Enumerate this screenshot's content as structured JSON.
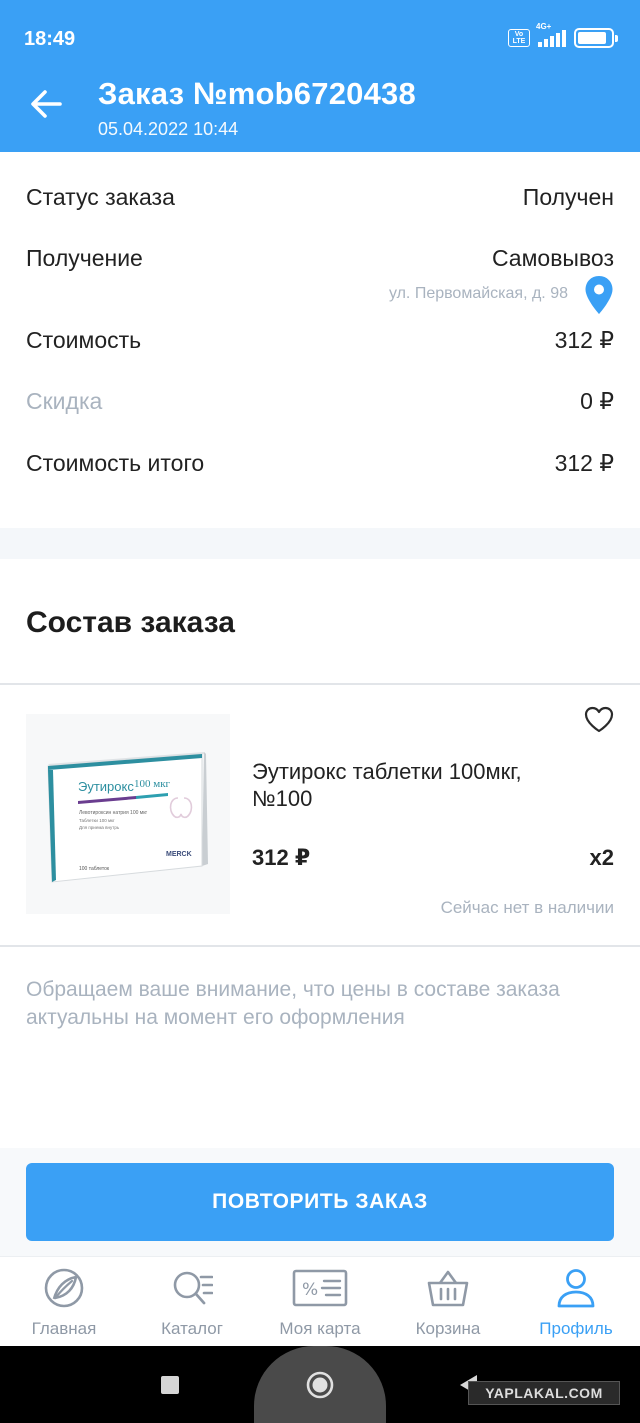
{
  "status_bar": {
    "time": "18:49",
    "network": "4G+",
    "volte": "Vo LTE"
  },
  "header": {
    "title": "Заказ №mob6720438",
    "date": "05.04.2022 10:44"
  },
  "order_info": {
    "status_label": "Статус заказа",
    "status_value": "Получен",
    "delivery_label": "Получение",
    "delivery_value": "Самовывоз",
    "address": "ул. Первомайская, д. 98",
    "cost_label": "Стоимость",
    "cost_value": "312 ₽",
    "discount_label": "Скидка",
    "discount_value": "0 ₽",
    "total_label": "Стоимость итого",
    "total_value": "312 ₽"
  },
  "composition": {
    "title": "Состав заказа",
    "items": [
      {
        "name": "Эутирокс таблетки 100мкг, №100",
        "price": "312 ₽",
        "qty": "x2",
        "stock": "Сейчас нет в наличии",
        "package": {
          "brand": "Эутирокс",
          "dose": "100 мкг",
          "substance": "Левотироксин натрия 100 мкг",
          "line1": "Таблетки 100 мкг",
          "line2": "Для приема внутрь",
          "count": "100 таблеток",
          "maker": "MERCK"
        }
      }
    ]
  },
  "notice": "Обращаем ваше внимание, что цены в составе заказа актуальны на момент его оформления",
  "actions": {
    "repeat_label": "ПОВТОРИТЬ ЗАКАЗ"
  },
  "bottom_nav": [
    {
      "label": "Главная",
      "icon": "home-leaf-icon"
    },
    {
      "label": "Каталог",
      "icon": "catalog-search-icon"
    },
    {
      "label": "Моя карта",
      "icon": "discount-card-icon"
    },
    {
      "label": "Корзина",
      "icon": "basket-icon"
    },
    {
      "label": "Профиль",
      "icon": "profile-icon",
      "active": true
    }
  ],
  "watermark": "YAPLAKAL.COM",
  "colors": {
    "primary": "#3aa0f5",
    "muted": "#a9b3bf",
    "nav_inactive": "#8f99a6"
  }
}
